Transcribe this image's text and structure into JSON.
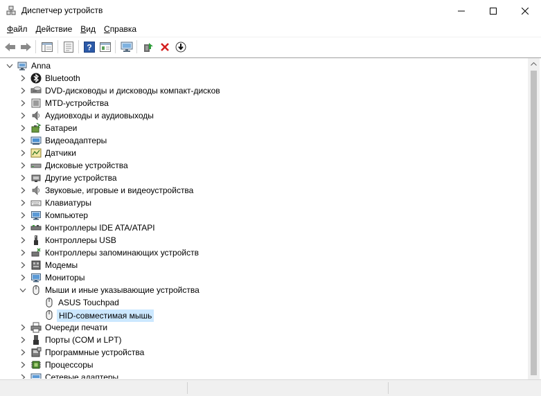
{
  "window": {
    "title": "Диспетчер устройств",
    "controls": [
      "minimize",
      "maximize",
      "close"
    ]
  },
  "menu": [
    {
      "underlined": "Ф",
      "rest": "айл"
    },
    {
      "underlined": "Д",
      "rest": "ействие"
    },
    {
      "underlined": "В",
      "rest": "ид"
    },
    {
      "underlined": "С",
      "rest": "правка"
    }
  ],
  "toolbar": {
    "buttons": [
      "back-icon",
      "forward-icon",
      "console-tree-icon",
      "properties-icon",
      "help-icon",
      "view-icon",
      "scan-hardware-icon",
      "update-driver-icon",
      "uninstall-icon",
      "disable-device-icon"
    ]
  },
  "tree": {
    "root": {
      "label": "Anna",
      "icon": "computer-icon"
    },
    "categories": [
      {
        "label": "Bluetooth",
        "icon": "bluetooth-icon"
      },
      {
        "label": "DVD-дисководы и дисководы компакт-дисков",
        "icon": "dvd-drive-icon"
      },
      {
        "label": "MTD-устройства",
        "icon": "mtd-device-icon"
      },
      {
        "label": "Аудиовходы и аудиовыходы",
        "icon": "speaker-icon"
      },
      {
        "label": "Батареи",
        "icon": "battery-icon"
      },
      {
        "label": "Видеоадаптеры",
        "icon": "display-adapter-icon"
      },
      {
        "label": "Датчики",
        "icon": "sensor-icon"
      },
      {
        "label": "Дисковые устройства",
        "icon": "disk-drive-icon"
      },
      {
        "label": "Другие устройства",
        "icon": "other-devices-icon"
      },
      {
        "label": "Звуковые, игровые и видеоустройства",
        "icon": "sound-icon"
      },
      {
        "label": "Клавиатуры",
        "icon": "keyboard-icon"
      },
      {
        "label": "Компьютер",
        "icon": "monitor-icon"
      },
      {
        "label": "Контроллеры IDE ATA/ATAPI",
        "icon": "ide-controller-icon"
      },
      {
        "label": "Контроллеры USB",
        "icon": "usb-icon"
      },
      {
        "label": "Контроллеры запоминающих устройств",
        "icon": "storage-controller-icon"
      },
      {
        "label": "Модемы",
        "icon": "modem-icon"
      },
      {
        "label": "Мониторы",
        "icon": "monitor-icon"
      },
      {
        "label": "Мыши и иные указывающие устройства",
        "icon": "mouse-icon",
        "expanded": true,
        "children": [
          {
            "label": "ASUS Touchpad",
            "icon": "mouse-icon"
          },
          {
            "label": "HID-совместимая мышь",
            "icon": "mouse-icon",
            "selected": true
          }
        ]
      },
      {
        "label": "Очереди печати",
        "icon": "printer-icon"
      },
      {
        "label": "Порты (COM и LPT)",
        "icon": "port-icon"
      },
      {
        "label": "Программные устройства",
        "icon": "software-device-icon"
      },
      {
        "label": "Процессоры",
        "icon": "processor-icon"
      },
      {
        "label": "Сетевые адаптеры",
        "icon": "network-adapter-icon"
      }
    ]
  },
  "colors": {
    "selection": "#cce8ff",
    "scrollbar_track": "#f0f0f0",
    "scrollbar_thumb": "#c1c1c1"
  }
}
